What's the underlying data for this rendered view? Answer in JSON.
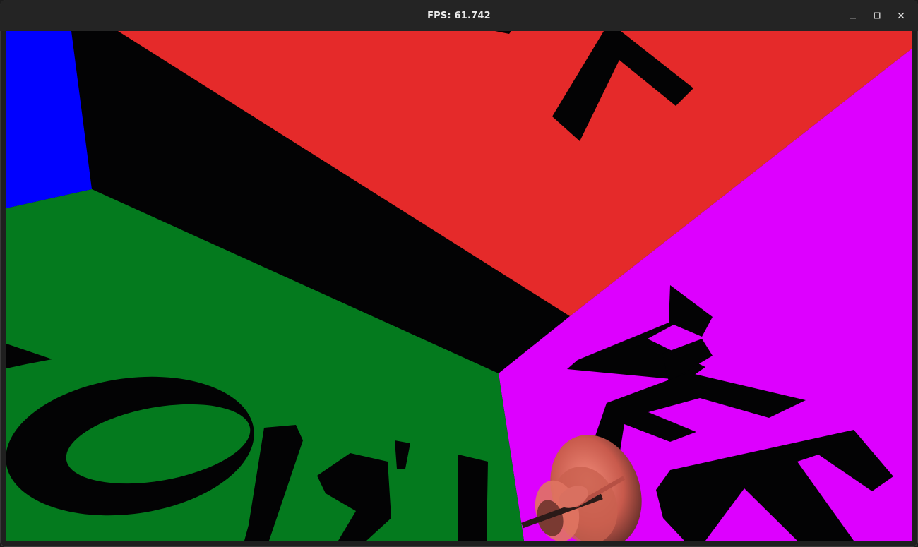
{
  "window": {
    "title": "FPS: 61.742",
    "controls": {
      "minimize_icon": "minimize-icon",
      "maximize_icon": "maximize-icon",
      "close_icon": "close-icon"
    }
  },
  "scene": {
    "description_colors": {
      "red_face": "#e52a2a",
      "magenta_face": "#dd00ff",
      "green_face": "#047a1e",
      "blue_face": "#0000ff",
      "black_edge": "#030304",
      "object_shading": "#d96c5e"
    }
  }
}
